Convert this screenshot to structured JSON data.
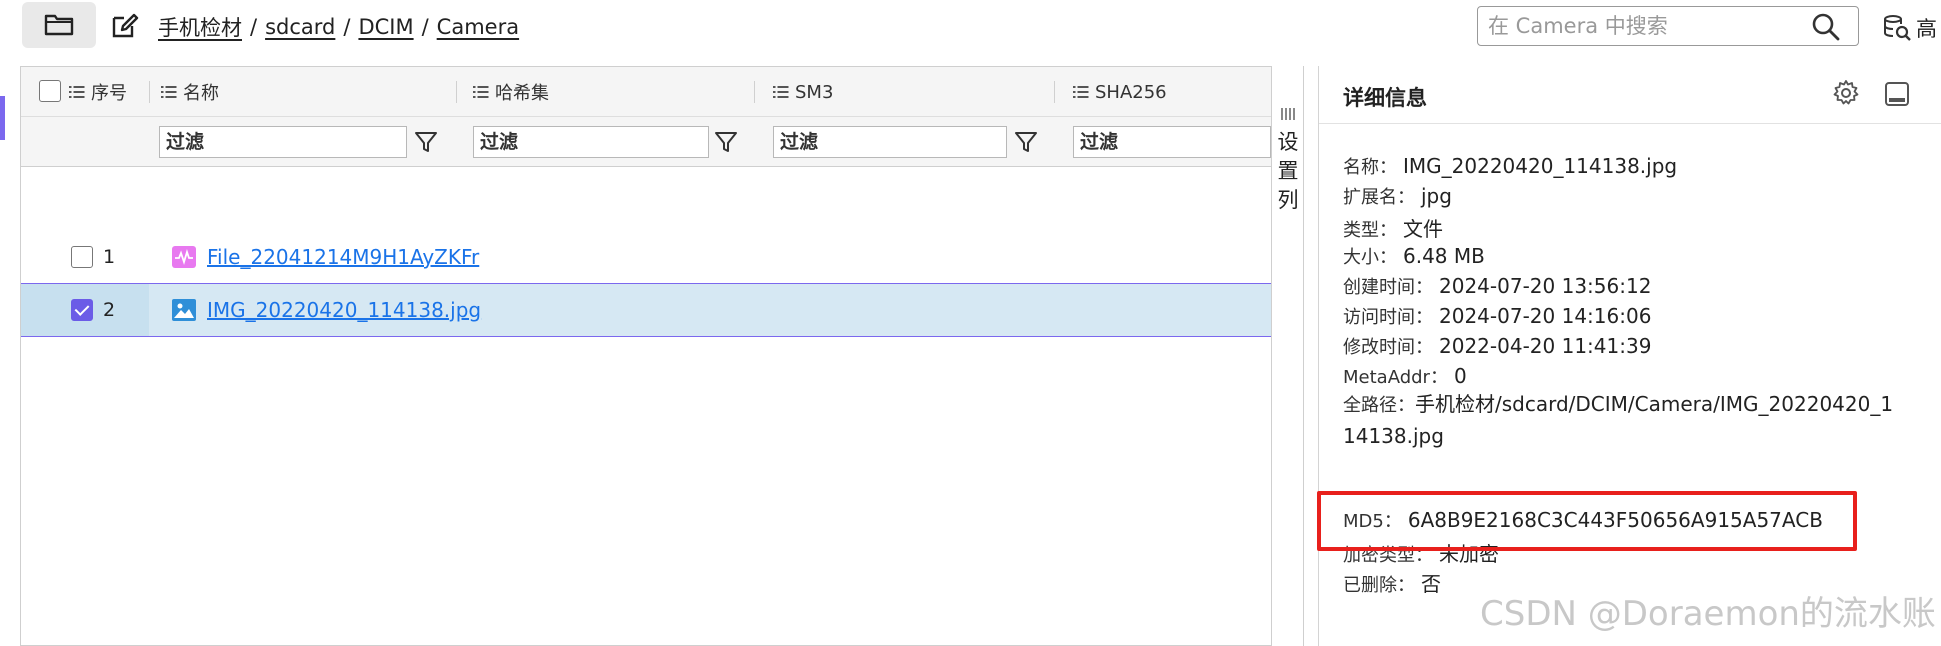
{
  "toolbar": {
    "breadcrumb": [
      "手机检材",
      "sdcard",
      "DCIM",
      "Camera"
    ],
    "separator": "/",
    "search_placeholder": "在 Camera 中搜索",
    "advanced_label": "高"
  },
  "table": {
    "columns": [
      "序号",
      "名称",
      "哈希集",
      "SM3",
      "SHA256"
    ],
    "filter_placeholder": "过滤",
    "rows": [
      {
        "index": "1",
        "name": "File_22041214M9H1AyZKFr",
        "checked": false,
        "selected": false,
        "icon": "audio-file-icon"
      },
      {
        "index": "2",
        "name": "IMG_20220420_114138.jpg",
        "checked": true,
        "selected": true,
        "icon": "image-file-icon"
      }
    ],
    "column_settings_label": "设置列"
  },
  "detail": {
    "title": "详细信息",
    "props": [
      {
        "key": "名称：",
        "value": "IMG_20220420_114138.jpg"
      },
      {
        "key": "扩展名：",
        "value": "jpg"
      },
      {
        "key": "类型：",
        "value": "文件"
      },
      {
        "key": "大小：",
        "value": "6.48 MB"
      },
      {
        "key": "创建时间：",
        "value": "2024-07-20 13:56:12"
      },
      {
        "key": "访问时间：",
        "value": "2024-07-20 14:16:06"
      },
      {
        "key": "修改时间：",
        "value": "2022-04-20 11:41:39"
      },
      {
        "key": "MetaAddr：",
        "value": "0"
      }
    ],
    "full_path": {
      "key": "全路径：",
      "value": "手机检材/sdcard/DCIM/Camera/IMG_20220420_114138.jpg"
    },
    "md5": {
      "key": "MD5：",
      "value": "6A8B9E2168C3C443F50656A915A57ACB"
    },
    "encryption": {
      "key": "加密类型：",
      "value": "未加密"
    },
    "deleted": {
      "key": "已删除：",
      "value": "否"
    }
  },
  "watermark": "CSDN @Doraemon的流水账",
  "colors": {
    "accent": "#6b5ce7",
    "link": "#1a73e8",
    "selected_row": "#d6e8f3",
    "highlight": "#e8201c"
  }
}
